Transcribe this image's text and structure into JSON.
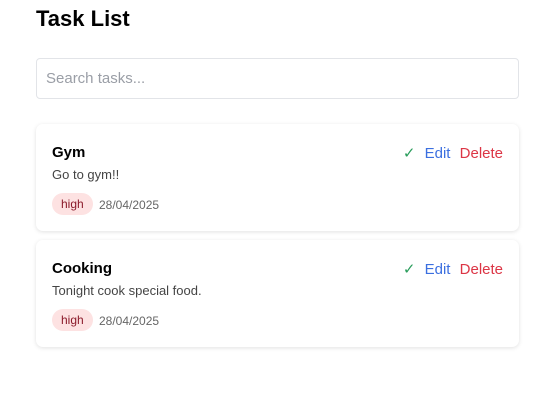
{
  "header": {
    "title": "Task List"
  },
  "search": {
    "placeholder": "Search tasks...",
    "value": ""
  },
  "tasks": [
    {
      "title": "Gym",
      "description": "Go to gym!!",
      "priority": "high",
      "date": "28/04/2025",
      "complete_label": "✓",
      "edit_label": "Edit",
      "delete_label": "Delete"
    },
    {
      "title": "Cooking",
      "description": "Tonight cook special food.",
      "priority": "high",
      "date": "28/04/2025",
      "complete_label": "✓",
      "edit_label": "Edit",
      "delete_label": "Delete"
    }
  ]
}
